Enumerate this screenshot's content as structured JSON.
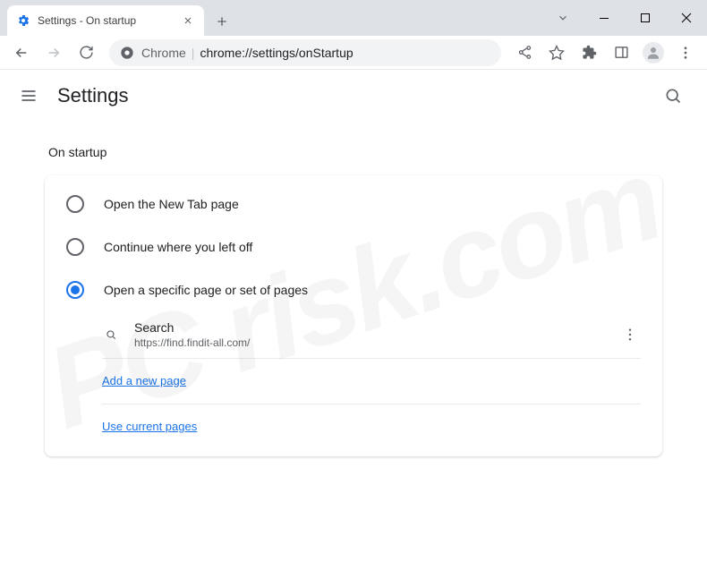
{
  "window": {
    "tab_title": "Settings - On startup"
  },
  "omnibox": {
    "scheme": "Chrome",
    "path": "chrome://settings/onStartup"
  },
  "header": {
    "title": "Settings"
  },
  "section": {
    "label": "On startup",
    "options": [
      {
        "label": "Open the New Tab page"
      },
      {
        "label": "Continue where you left off"
      },
      {
        "label": "Open a specific page or set of pages"
      }
    ],
    "startup_page": {
      "name": "Search",
      "url": "https://find.findit-all.com/"
    },
    "links": {
      "add": "Add a new page",
      "use_current": "Use current pages"
    }
  },
  "watermark": "PC\nrisk.com"
}
